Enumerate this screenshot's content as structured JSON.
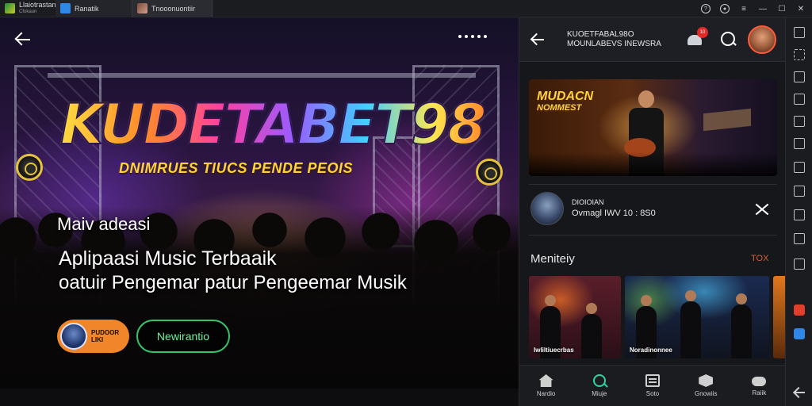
{
  "titlebar": {
    "tabs": [
      {
        "label": "Llaiotrastanr",
        "sublabel": "Cfokaun",
        "icon": "app-icon"
      },
      {
        "label": "Ranatik",
        "icon": "blue-app-icon"
      },
      {
        "label": "Tnooonuontiir",
        "icon": "photo-app-icon"
      }
    ],
    "controls": [
      "help-icon",
      "settings-icon",
      "menu-icon",
      "minimize-icon",
      "maximize-icon",
      "close-icon"
    ]
  },
  "hero": {
    "logo": "KUDETABET98",
    "tagline": "DNIMRUES TIUCS PENDE PEOIS",
    "kicker": "Maiv adeasi",
    "headline": "Aplipaasi Music Terbaaik",
    "subline": "oatuir Pengemar patur Pengeemar Musik",
    "primary_button": "PUDOOR LIKI",
    "secondary_button": "Newirantio"
  },
  "panel": {
    "title_line1": "KUOETFABAL98O",
    "title_line2": "MOUNLABEVS INEWSRA",
    "notification_count": "10",
    "banner_title_line1": "MUDACN",
    "banner_title_line2": "NOMMEST",
    "song_title": "DIOIOIAN",
    "song_meta": "Ovmagl IWV 10 : 8S0",
    "section_title": "Meniteiy",
    "section_link": "TOX",
    "cards": [
      {
        "label": "Iwliltiuecrbas"
      },
      {
        "label": "Noradinonnee"
      },
      {
        "label": ""
      }
    ],
    "nav": [
      {
        "label": "Nardio",
        "icon": "home-icon"
      },
      {
        "label": "Miuje",
        "icon": "search-icon"
      },
      {
        "label": "Soto",
        "icon": "library-icon"
      },
      {
        "label": "Gnowiis",
        "icon": "badge-icon"
      },
      {
        "label": "Raiik",
        "icon": "gamepad-icon"
      }
    ]
  },
  "colors": {
    "accent_orange": "#f0852a",
    "accent_green": "#34c46a",
    "badge_red": "#e32828",
    "link_orange": "#d4603a"
  }
}
